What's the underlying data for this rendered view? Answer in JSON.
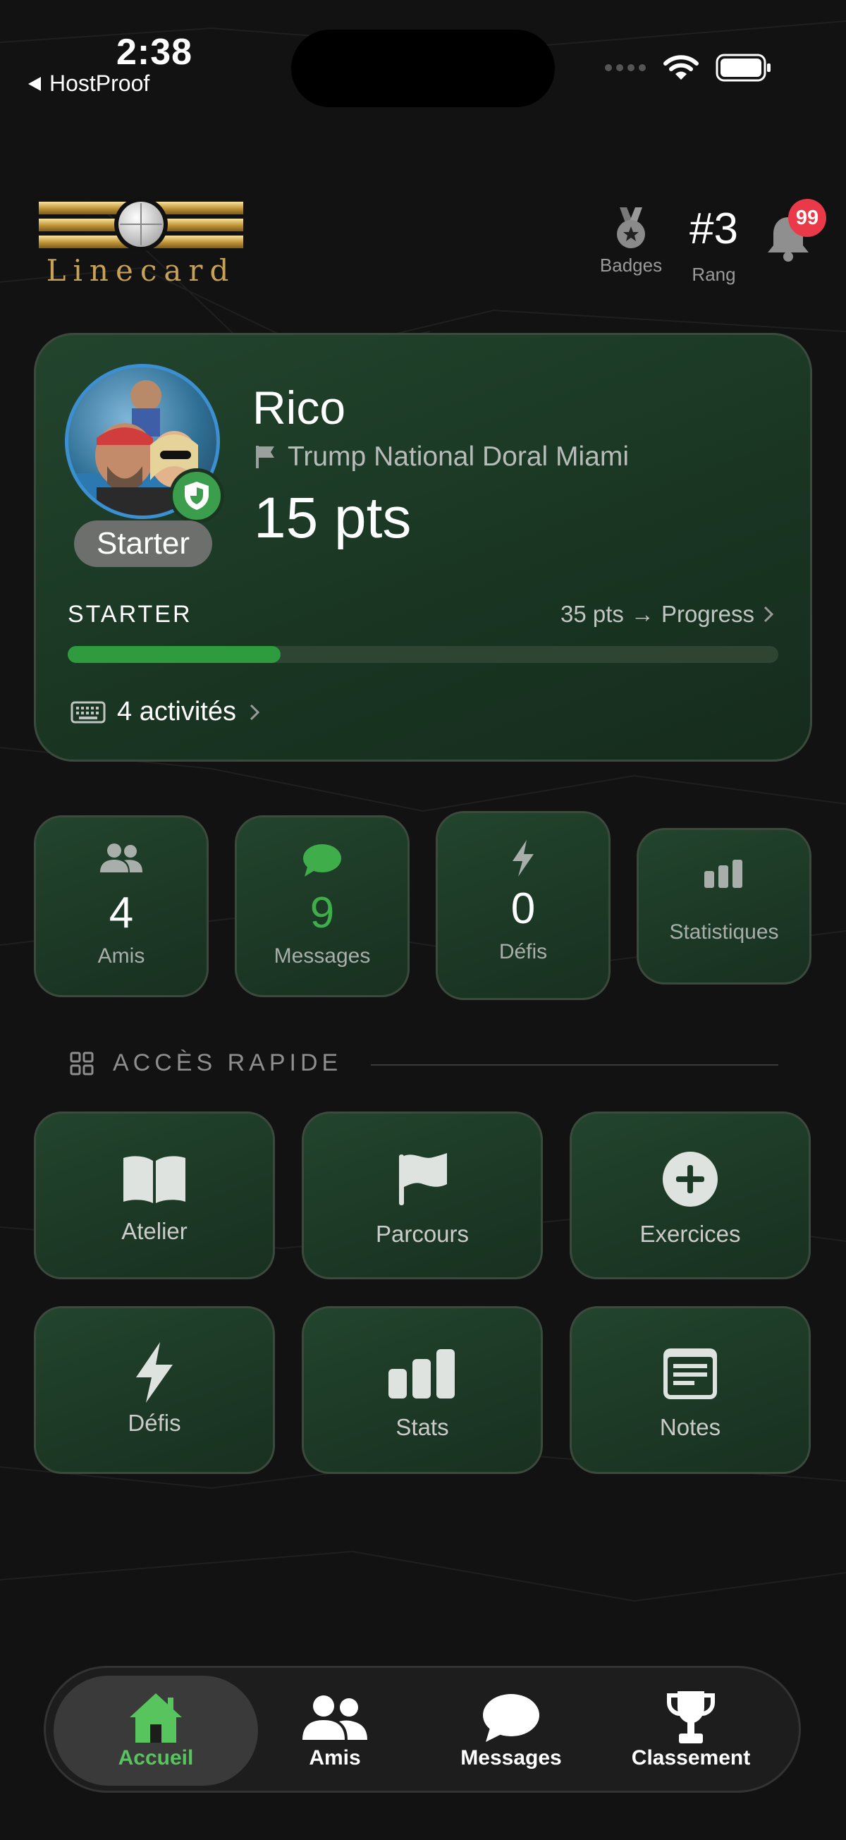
{
  "status_bar": {
    "time": "2:38",
    "back_app": "HostProof"
  },
  "header": {
    "logo_text": "Linecard",
    "badges_label": "Badges",
    "rank_value": "#3",
    "rank_label": "Rang",
    "notification_count": "99"
  },
  "profile": {
    "name": "Rico",
    "course": "Trump National Doral Miami",
    "points": "15 pts",
    "level_badge": "Starter",
    "level_title": "STARTER",
    "next_points": "35 pts",
    "progress_label": "Progress",
    "progress_fraction": 0.3,
    "activities": "4 activités"
  },
  "stats": [
    {
      "icon": "friends-icon",
      "value": "4",
      "label": "Amis"
    },
    {
      "icon": "message-icon",
      "value": "9",
      "label": "Messages"
    },
    {
      "icon": "lightning-icon",
      "value": "0",
      "label": "Défis"
    },
    {
      "icon": "bar-chart-icon",
      "value": "",
      "label": "Statistiques"
    }
  ],
  "quick_access": {
    "title": "ACCÈS RAPIDE",
    "items": [
      {
        "icon": "book-icon",
        "label": "Atelier"
      },
      {
        "icon": "flag-icon",
        "label": "Parcours"
      },
      {
        "icon": "plus-circle-icon",
        "label": "Exercices"
      },
      {
        "icon": "lightning-icon",
        "label": "Défis"
      },
      {
        "icon": "bar-chart-icon",
        "label": "Stats"
      },
      {
        "icon": "notes-icon",
        "label": "Notes"
      }
    ]
  },
  "tabs": [
    {
      "icon": "home-icon",
      "label": "Accueil",
      "active": true
    },
    {
      "icon": "friends-icon",
      "label": "Amis"
    },
    {
      "icon": "message-icon",
      "label": "Messages"
    },
    {
      "icon": "trophy-icon",
      "label": "Classement"
    }
  ],
  "colors": {
    "accent_green": "#2e9b3f",
    "active_tab": "#58c45e",
    "notification_red": "#ea3a4a"
  }
}
